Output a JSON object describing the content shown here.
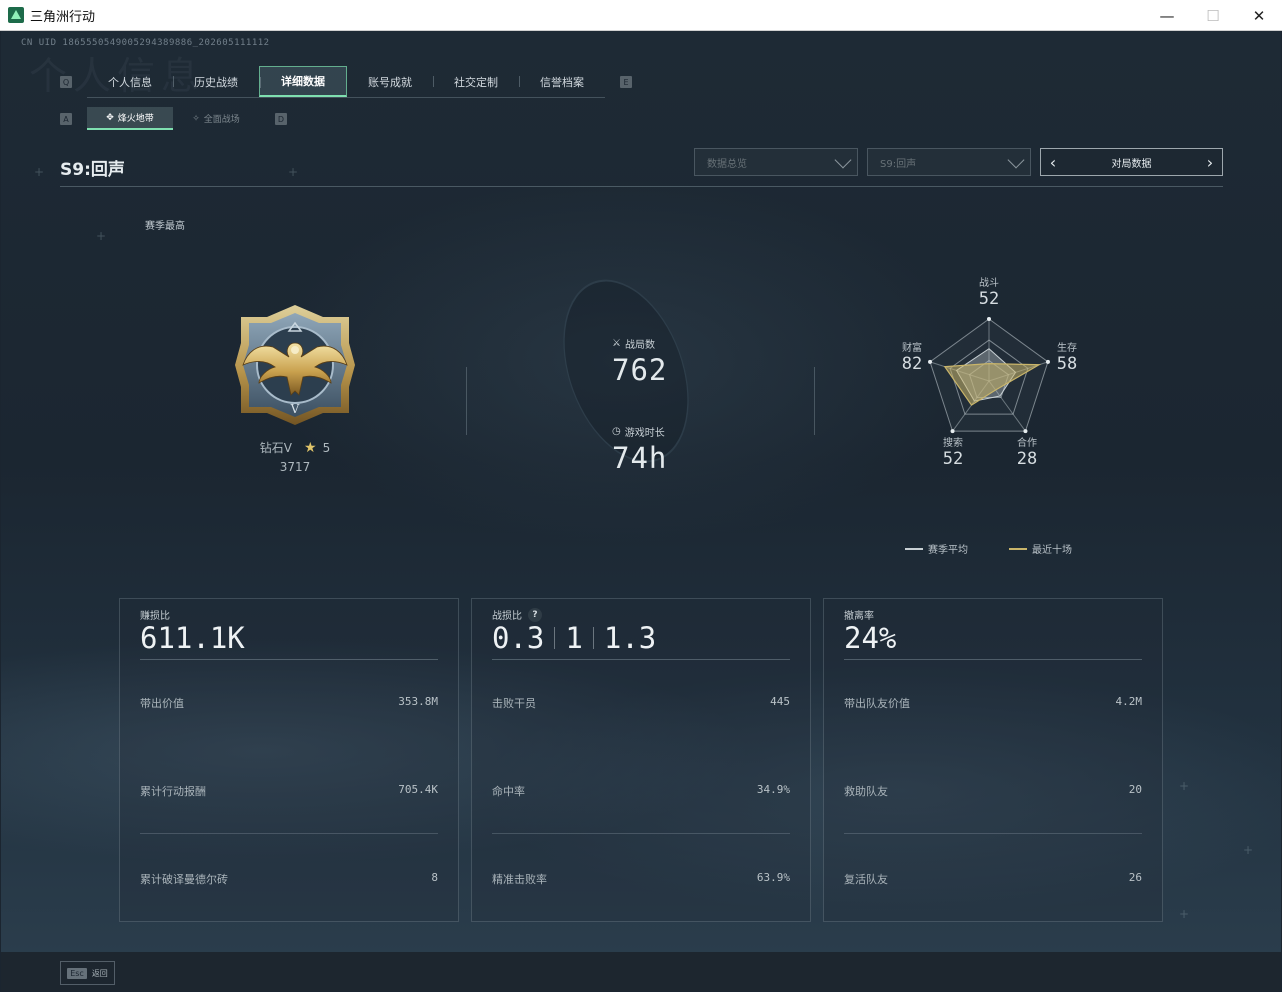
{
  "window": {
    "title": "三角洲行动",
    "minimize": "—",
    "maximize": "☐",
    "close": "✕"
  },
  "header": {
    "uid": "CN UID 1865550549005294389886_202605111112",
    "ghost_title": "个人信息"
  },
  "tabs": [
    {
      "label": "个人信息",
      "active": false
    },
    {
      "label": "历史战绩",
      "active": false
    },
    {
      "label": "详细数据",
      "active": true
    },
    {
      "label": "账号成就",
      "active": false
    },
    {
      "label": "社交定制",
      "active": false
    },
    {
      "label": "信誉档案",
      "active": false
    }
  ],
  "tab_keys": {
    "left": "Q",
    "right": "E"
  },
  "subtabs": [
    {
      "label": "烽火地带",
      "icon": "✥",
      "active": true
    },
    {
      "label": "全面战场",
      "icon": "✧",
      "active": false
    }
  ],
  "subtab_keys": {
    "left": "A",
    "right": "D"
  },
  "season": {
    "title": "S9:回声"
  },
  "filters": {
    "dropdown1": "数据总览",
    "dropdown2": "S9:回声",
    "pager_label": "对局数据",
    "prev": "‹",
    "next": "›"
  },
  "rank": {
    "section_label": "赛季最高",
    "tier": "钻石V",
    "stars": "5",
    "score": "3717",
    "medal_numeral": "V"
  },
  "summary": {
    "matches_label": "战局数",
    "matches_value": "762",
    "playtime_label": "游戏时长",
    "playtime_value": "74h"
  },
  "radar": {
    "axes": [
      {
        "label": "战斗",
        "value": "52"
      },
      {
        "label": "生存",
        "value": "58"
      },
      {
        "label": "合作",
        "value": "28"
      },
      {
        "label": "搜索",
        "value": "52"
      },
      {
        "label": "财富",
        "value": "82"
      }
    ],
    "season_avg": [
      0.52,
      0.45,
      0.3,
      0.4,
      0.55
    ],
    "recent": [
      0.28,
      0.85,
      0.18,
      0.48,
      0.75
    ],
    "legend_avg": "赛季平均",
    "legend_recent": "最近十场",
    "color_avg": "#c8d0d4",
    "color_recent": "#c9b56a"
  },
  "cards": [
    {
      "title": "赚损比",
      "big": [
        "611.1K"
      ],
      "rows": [
        {
          "label": "带出价值",
          "value": "353.8M"
        },
        {
          "label": "累计行动报酬",
          "value": "705.4K"
        },
        {
          "label": "累计破译曼德尔砖",
          "value": "8"
        }
      ]
    },
    {
      "title": "战损比",
      "help": "?",
      "big": [
        "0.3",
        "1",
        "1.3"
      ],
      "rows": [
        {
          "label": "击败干员",
          "value": "445"
        },
        {
          "label": "命中率",
          "value": "34.9%"
        },
        {
          "label": "精准击败率",
          "value": "63.9%"
        }
      ]
    },
    {
      "title": "撤离率",
      "big": [
        "24%"
      ],
      "rows": [
        {
          "label": "带出队友价值",
          "value": "4.2M"
        },
        {
          "label": "救助队友",
          "value": "20"
        },
        {
          "label": "复活队友",
          "value": "26"
        }
      ]
    }
  ],
  "footer": {
    "esc_key": "Esc",
    "esc_label": "返回"
  }
}
